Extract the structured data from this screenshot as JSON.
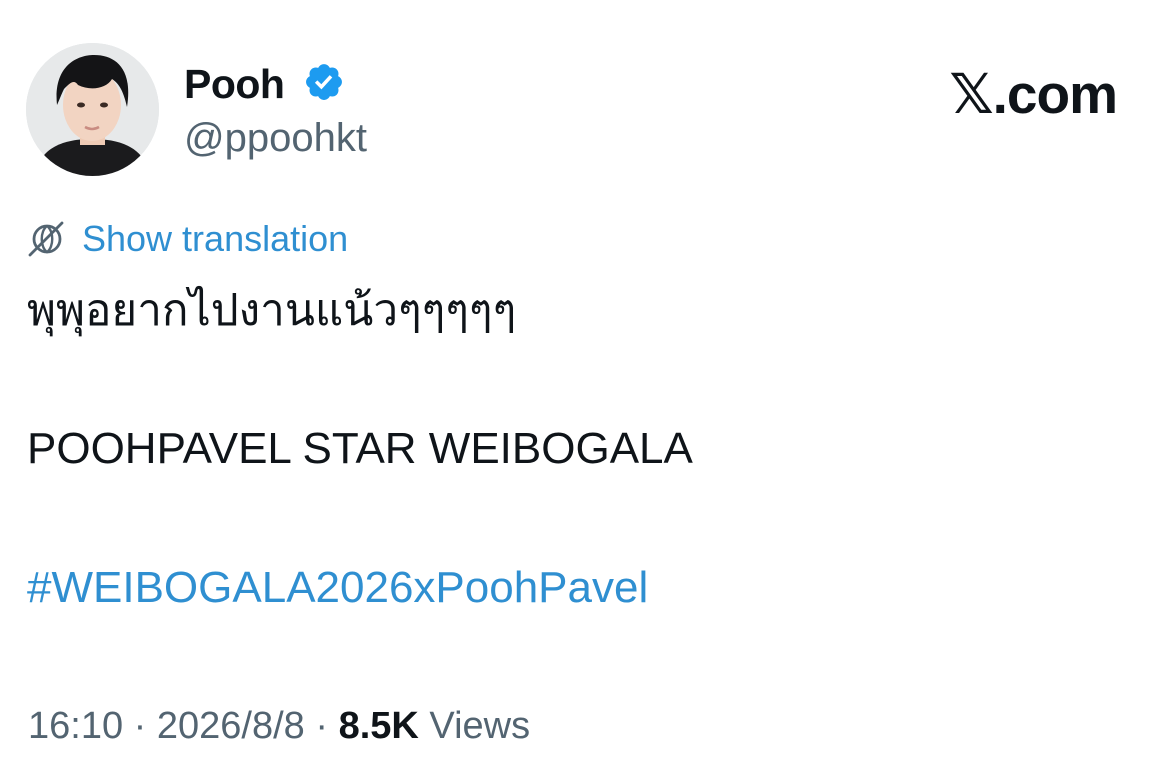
{
  "author": {
    "display_name": "Pooh",
    "handle": "@ppoohkt",
    "verified_icon": "verified-badge-icon",
    "avatar": "profile-photo"
  },
  "site": {
    "logo_text": "𝕏.com"
  },
  "translation": {
    "icon": "globe-icon",
    "link_label": "Show translation"
  },
  "tweet": {
    "lines": [
      "พุพุอยากไปงานแน้วๆๆๆๆๆ",
      "POOHPAVEL STAR WEIBOGALA",
      "#WEIBOGALA2026xPoohPavel"
    ]
  },
  "meta": {
    "time": "16:10",
    "separator": "·",
    "date": "2026/8/8",
    "views_count": "8.5K",
    "views_label": "Views"
  },
  "colors": {
    "link": "#2f8fd1",
    "verified": "#1d9bf0",
    "secondary_text": "#536471",
    "primary_text": "#0f1419"
  }
}
